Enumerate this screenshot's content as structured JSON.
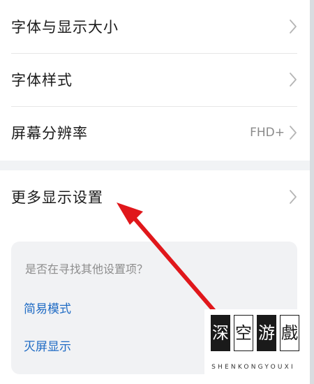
{
  "settings": {
    "rows": [
      {
        "label": "字体与显示大小",
        "value": ""
      },
      {
        "label": "字体样式",
        "value": ""
      },
      {
        "label": "屏幕分辨率",
        "value": "FHD+"
      },
      {
        "label": "更多显示设置",
        "value": ""
      }
    ]
  },
  "suggestions": {
    "title": "是否在寻找其他设置项？",
    "links": [
      "简易模式",
      "灭屏显示"
    ]
  },
  "annotation": {
    "arrow_color": "#e0171b"
  },
  "watermark": {
    "chars": [
      "深",
      "空",
      "游",
      "戲"
    ],
    "subtitle": "SHENKONGYOUXI"
  }
}
